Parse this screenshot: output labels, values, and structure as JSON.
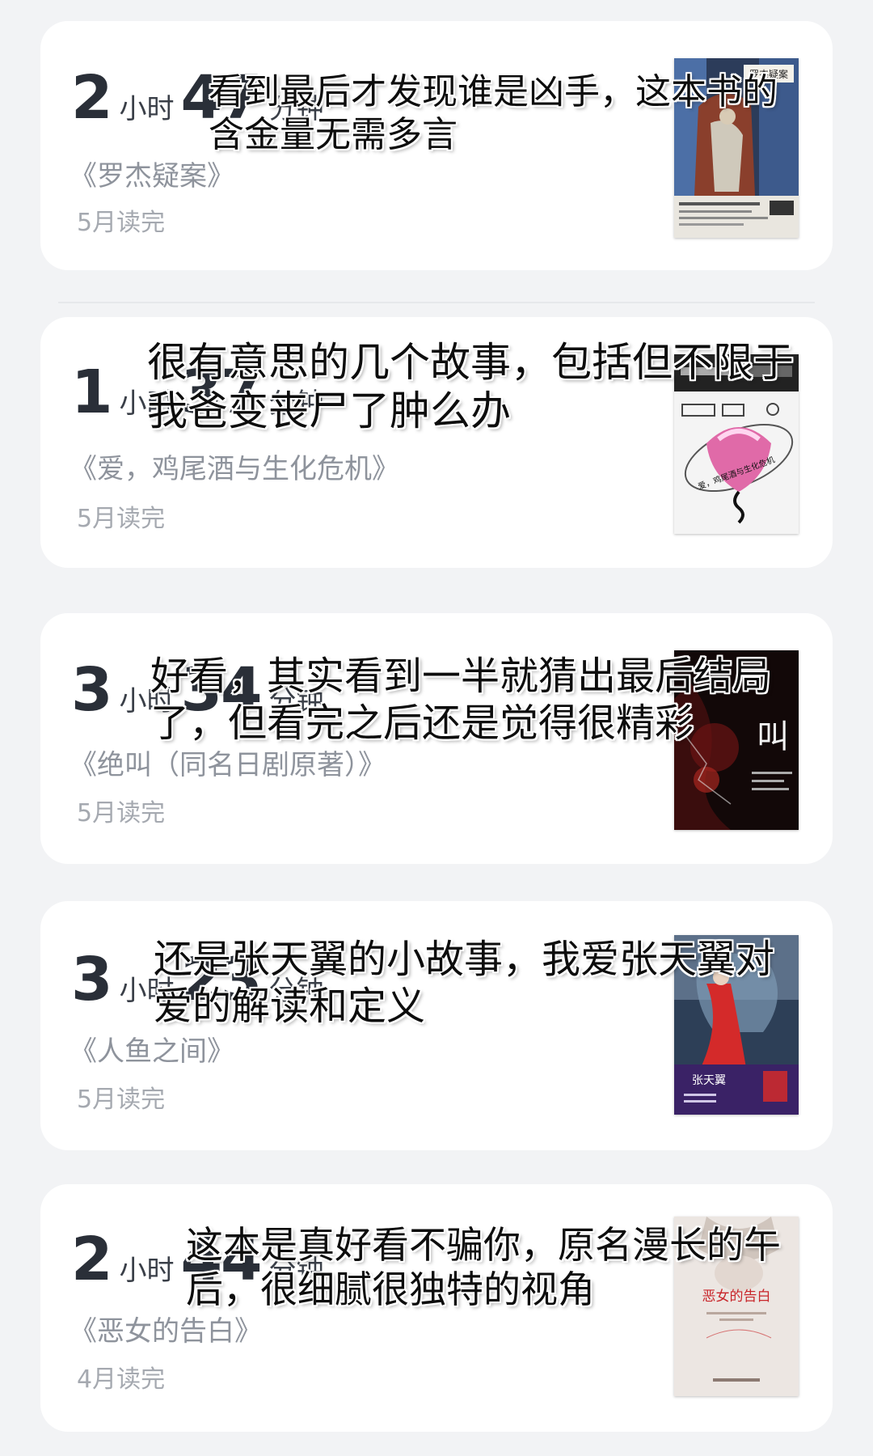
{
  "books": [
    {
      "hours": "2",
      "hours_unit": "小时",
      "minutes": "47",
      "minutes_unit": "分钟",
      "title": "《罗杰疑案》",
      "status": "5月读完",
      "cover_text": "罗杰疑案",
      "caption_line1": "看到最后才发现谁是凶手，这本书的",
      "caption_line2": "含金量无需多言"
    },
    {
      "hours": "1",
      "hours_unit": "小时",
      "minutes": "37",
      "minutes_unit": "分钟",
      "title": "《爱，鸡尾酒与生化危机》",
      "status": "5月读完",
      "cover_text": "爱，鸡尾酒与生化危机",
      "caption_line1": "很有意思的几个故事，包括但不限于",
      "caption_line2": "我爸变丧尸了肿么办"
    },
    {
      "hours": "3",
      "hours_unit": "小时",
      "minutes": "34",
      "minutes_unit": "分钟",
      "title": "《绝叫（同名日剧原著）》",
      "status": "5月读完",
      "cover_text": "叫",
      "caption_line1": "好看，其实看到一半就猜出最后结局",
      "caption_line2": "了，但看完之后还是觉得很精彩"
    },
    {
      "hours": "3",
      "hours_unit": "小时",
      "minutes": "23",
      "minutes_unit": "分钟",
      "title": "《人鱼之间》",
      "status": "5月读完",
      "cover_text": "张天翼",
      "caption_line1": "还是张天翼的小故事，我爱张天翼对",
      "caption_line2": "爱的解读和定义"
    },
    {
      "hours": "2",
      "hours_unit": "小时",
      "minutes": "44",
      "minutes_unit": "分钟",
      "title": "《恶女的告白》",
      "status": "4月读完",
      "cover_text": "恶女的告白",
      "caption_line1": "这本是真好看不骗你，原名漫长的午",
      "caption_line2": "后，很细腻很独特的视角"
    }
  ],
  "icons": [
    "book-cover-image"
  ]
}
